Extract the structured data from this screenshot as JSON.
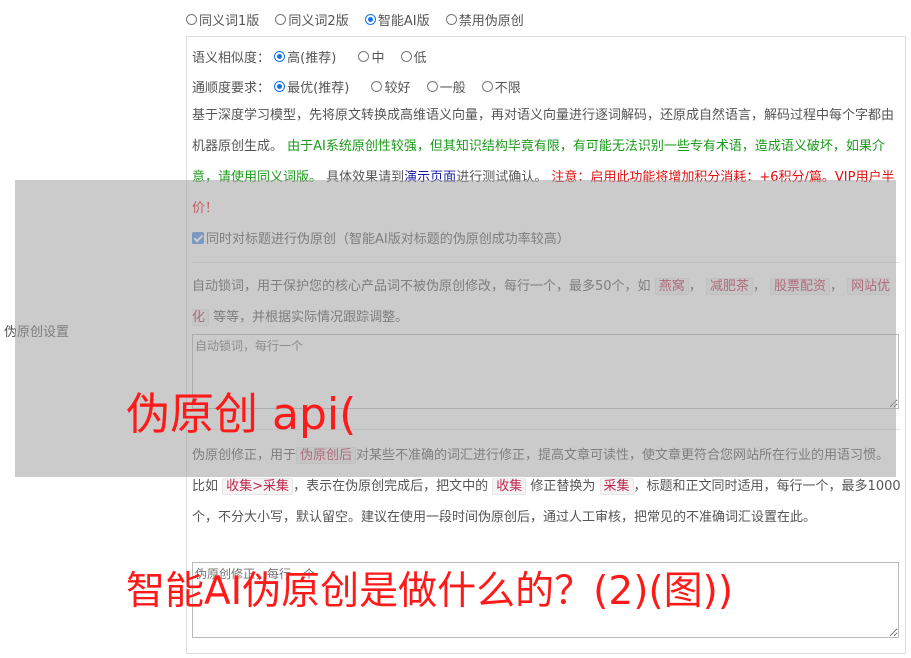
{
  "mode_options": [
    "同义词1版",
    "同义词2版",
    "智能AI版",
    "禁用伪原创"
  ],
  "mode_selected": "智能AI版",
  "similarity": {
    "label": "语义相似度：",
    "options": [
      "高(推荐)",
      "中",
      "低"
    ],
    "selected": "高(推荐)"
  },
  "fluency": {
    "label": "通顺度要求：",
    "options": [
      "最优(推荐)",
      "较好",
      "一般",
      "不限"
    ],
    "selected": "最优(推荐)"
  },
  "desc": {
    "part1": "基于深度学习模型，先将原文转换成高维语义向量，再对语义向量进行逐词解码，还原成自然语言，解码过程中每个字都由机器原创生成。",
    "part2_green": "由于AI系统原创性较强，但其知识结构毕竟有限，有可能无法识别一些专有术语，造成语义破坏，如果介意，请使用同义词版。",
    "part3": "具体效果请到",
    "part4_link": "演示页面",
    "part5": "进行测试确认。",
    "part6_red": "注意：启用此功能将增加积分消耗：+6积分/篇。VIP用户半价！"
  },
  "title_checkbox_label": "同时对标题进行伪原创（智能AI版对标题的伪原创成功率较高）",
  "side_label": "伪原创设置",
  "lock": {
    "text1": "自动锁词，用于保护您的核心产品词不被伪原创修改，每行一个，最多50个，如",
    "tags": [
      "燕窝",
      "减肥茶",
      "股票配资",
      "网站优化"
    ],
    "text2": "等等，并根据实际情况跟踪调整。",
    "placeholder": "自动锁词，每行一个"
  },
  "fix": {
    "text1": "伪原创修正，用于",
    "tag1": "伪原创后",
    "text2": "对某些不准确的词汇进行修正，提高文章可读性，使文章更符合您网站所在行业的用语习惯。比如",
    "tag2": "收集>采集",
    "text3": "，表示在伪原创完成后，把文中的",
    "tag3": "收集",
    "text4": "修正替换为",
    "tag4": "采集",
    "text5": "，标题和正文同时适用，每行一个，最多1000个，不分大小写，默认留空。建议在使用一段时间伪原创后，通过人工审核，把常见的不准确词汇设置在此。",
    "placeholder": "伪原创修正，每行一个"
  },
  "overlay_text_1": "伪原创 api(",
  "overlay_text_2": "智能AI伪原创是做什么的？(2)(图))",
  "colors": {
    "green": "#1a9a1a",
    "red": "#e01010",
    "link": "#1a1aa8",
    "overlay_text": "#ff1a1a"
  }
}
